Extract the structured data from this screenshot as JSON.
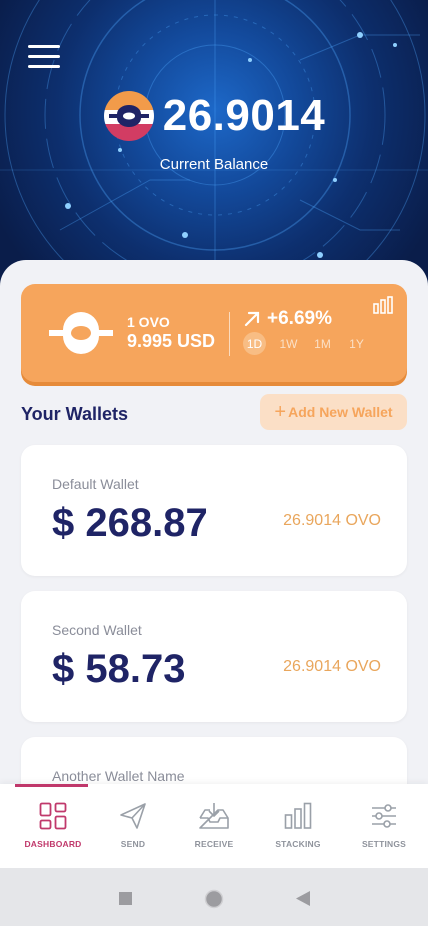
{
  "header": {
    "balance": "26.9014",
    "balance_label": "Current Balance"
  },
  "price_card": {
    "unit": "1 OVO",
    "usd_value": "9.995 USD",
    "change": "+6.69%",
    "periods": [
      "1D",
      "1W",
      "1M",
      "1Y"
    ],
    "active_period": "1D"
  },
  "wallets": {
    "title": "Your Wallets",
    "add_label": "Add New Wallet",
    "items": [
      {
        "name": "Default Wallet",
        "amount": "$ 268.87",
        "ovo": "26.9014 OVO"
      },
      {
        "name": "Second Wallet",
        "amount": "$ 58.73",
        "ovo": "26.9014 OVO"
      },
      {
        "name": "Another Wallet Name",
        "amount": "",
        "ovo": ""
      }
    ]
  },
  "nav": {
    "items": [
      {
        "label": "DASHBOARD",
        "icon": "dashboard-icon"
      },
      {
        "label": "SEND",
        "icon": "send-icon"
      },
      {
        "label": "RECEIVE",
        "icon": "receive-icon"
      },
      {
        "label": "STACKING",
        "icon": "stacking-icon"
      },
      {
        "label": "SETTINGS",
        "icon": "settings-icon"
      }
    ],
    "active": "DASHBOARD"
  },
  "colors": {
    "accent_orange": "#f6a55c",
    "navy": "#1f2466",
    "active_nav": "#c0386b"
  }
}
